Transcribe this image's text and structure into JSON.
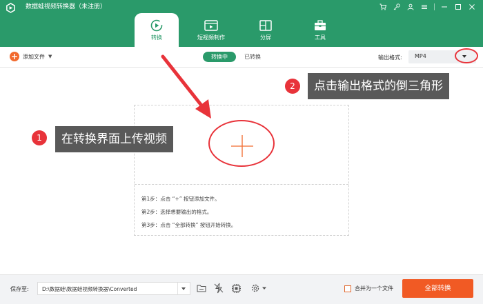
{
  "app": {
    "title": "数据蛙视频转换器（未注册）"
  },
  "tabs": [
    {
      "label": "转换",
      "icon": "convert-icon",
      "active": true
    },
    {
      "label": "短视频制作",
      "icon": "short-video-icon",
      "active": false
    },
    {
      "label": "分屏",
      "icon": "split-screen-icon",
      "active": false
    },
    {
      "label": "工具",
      "icon": "toolbox-icon",
      "active": false
    }
  ],
  "toolbar": {
    "add_file_label": "添加文件",
    "segments": [
      "转换中",
      "已转换"
    ],
    "output_format_label": "输出格式:",
    "output_format_value": "MP4"
  },
  "dropzone": {
    "steps": [
      "第1步：点击 “+” 按钮添加文件。",
      "第2步：选择想要输出的格式。",
      "第3步：点击 “全部转换” 按钮开始转换。"
    ]
  },
  "annotations": [
    {
      "number": "1",
      "text": "在转换界面上传视频"
    },
    {
      "number": "2",
      "text": "点击输出格式的倒三角形"
    }
  ],
  "footer": {
    "save_to_label": "保存至:",
    "save_path": "D:\\数据蛙\\数据蛙视频转换器\\Converted",
    "merge_label": "合并为一个文件",
    "convert_all_label": "全部转换"
  },
  "colors": {
    "brand_green": "#2a9a6a",
    "accent_orange": "#f15a24",
    "annotation_red": "#e8333a"
  }
}
